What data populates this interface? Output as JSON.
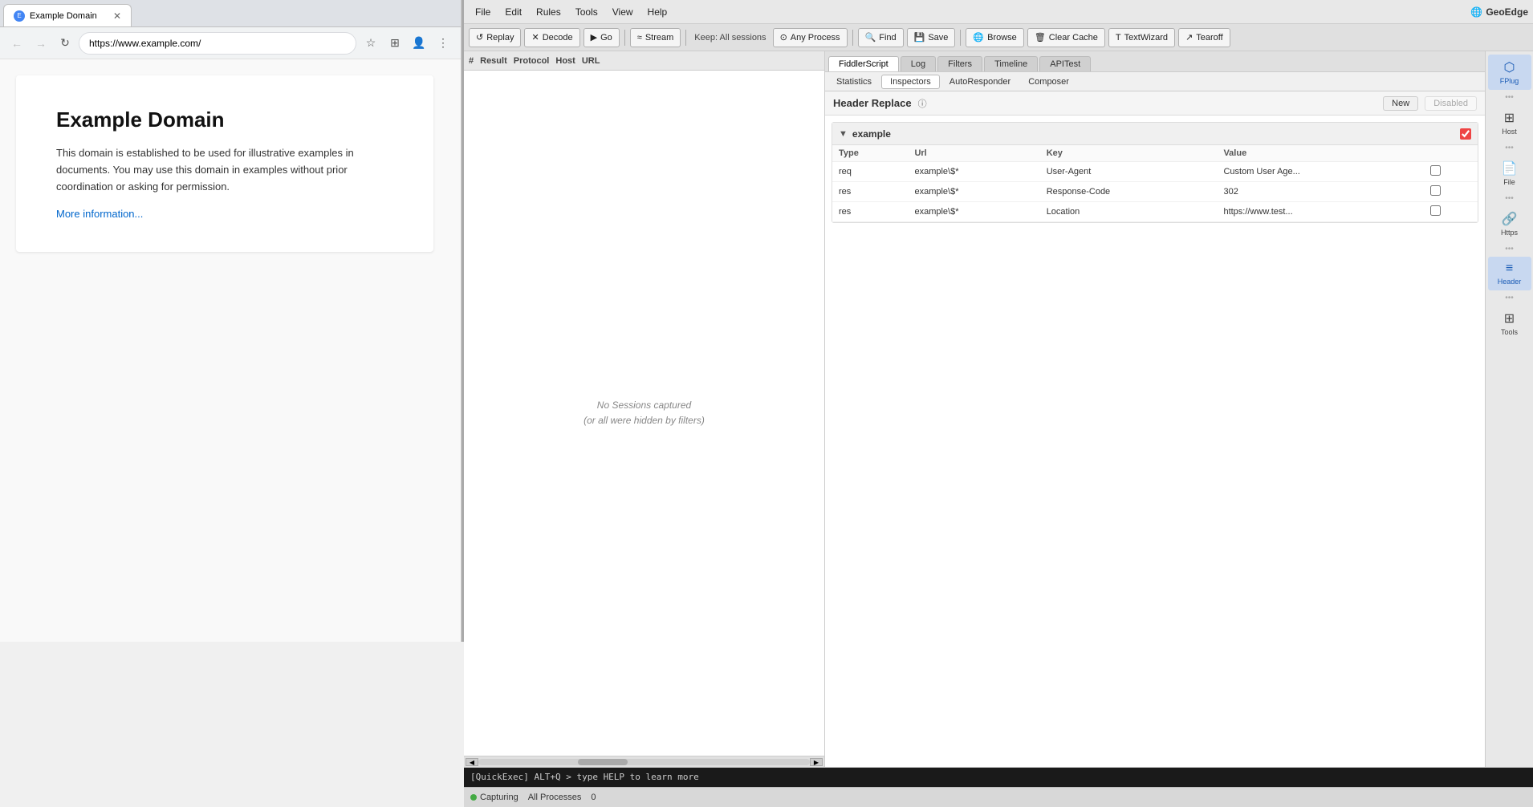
{
  "browser": {
    "tab_title": "Example Domain",
    "tab_favicon": "E",
    "url": "https://www.example.com/",
    "page_title": "Example Domain",
    "page_body": "This domain is established to be used for illustrative examples in documents. You may use this domain in examples without prior coordination or asking for permission.",
    "page_link": "More information..."
  },
  "fiddler": {
    "menu": {
      "file": "File",
      "edit": "Edit",
      "rules": "Rules",
      "tools": "Tools",
      "view": "View",
      "help": "Help"
    },
    "logo": "GeoEdge",
    "toolbar": {
      "replay": "Replay",
      "decode": "Decode",
      "go": "Go",
      "stream": "Stream",
      "keep_label": "Keep: All sessions",
      "any_process": "Any Process",
      "find": "Find",
      "save": "Save",
      "browse": "Browse",
      "clear_cache": "Clear Cache",
      "text_wizard": "TextWizard",
      "tearoff": "Tearoff"
    },
    "sessions": {
      "col_hash": "#",
      "col_result": "Result",
      "col_protocol": "Protocol",
      "col_host": "Host",
      "col_url": "URL",
      "no_sessions_line1": "No Sessions captured",
      "no_sessions_line2": "(or all were hidden by filters)"
    },
    "inspector": {
      "tabs": [
        "FiddlerScript",
        "Log",
        "Filters",
        "Timeline",
        "APITest"
      ],
      "subtabs": [
        "Statistics",
        "Inspectors",
        "AutoResponder",
        "Composer"
      ],
      "active_tab": "FiddlerScript",
      "active_subtab": "Inspectors"
    },
    "header_replace": {
      "title": "Header Replace",
      "new_btn": "New",
      "disabled_btn": "Disabled",
      "group_name": "example",
      "group_checked": true,
      "table_headers": [
        "Type",
        "Url",
        "Key",
        "Value",
        ""
      ],
      "rows": [
        {
          "type": "req",
          "url": "example\\$*",
          "key": "User-Agent",
          "value": "Custom User Age...",
          "checked": false
        },
        {
          "type": "res",
          "url": "example\\$*",
          "key": "Response-Code",
          "value": "302",
          "checked": false
        },
        {
          "type": "res",
          "url": "example\\$*",
          "key": "Location",
          "value": "https://www.test...",
          "checked": false
        }
      ]
    },
    "right_sidebar": {
      "items": [
        {
          "id": "fplug",
          "icon": "⬡",
          "label": "FPlug",
          "active": true
        },
        {
          "id": "host",
          "icon": "⊞",
          "label": "Host",
          "active": false
        },
        {
          "id": "file",
          "icon": "📄",
          "label": "File",
          "active": false
        },
        {
          "id": "https",
          "icon": "🔗",
          "label": "Https",
          "active": false
        },
        {
          "id": "header",
          "icon": "≡",
          "label": "Header",
          "active": true
        },
        {
          "id": "tools",
          "icon": "⊞",
          "label": "Tools",
          "active": false
        }
      ]
    },
    "status_bar": {
      "capturing": "Capturing",
      "all_processes": "All Processes",
      "count": "0"
    },
    "quickexec": "[QuickExec] ALT+Q > type HELP to learn more"
  }
}
